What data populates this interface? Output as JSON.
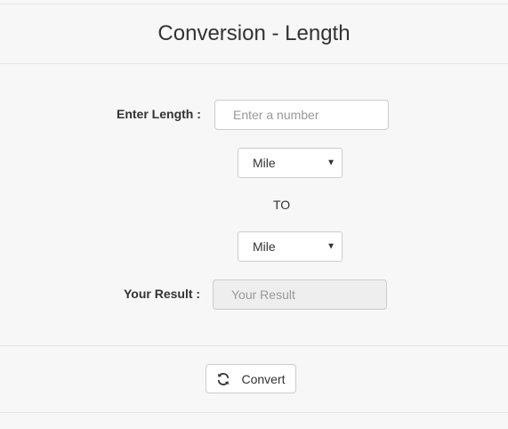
{
  "page": {
    "title": "Conversion - Length"
  },
  "form": {
    "length_label": "Enter Length :",
    "length_placeholder": "Enter a number",
    "length_value": "",
    "from_unit": "Mile",
    "to_text": "TO",
    "to_unit": "Mile",
    "result_label": "Your Result :",
    "result_placeholder": "Your Result",
    "result_value": ""
  },
  "actions": {
    "convert_label": "Convert",
    "convert_icon": "refresh-icon"
  }
}
